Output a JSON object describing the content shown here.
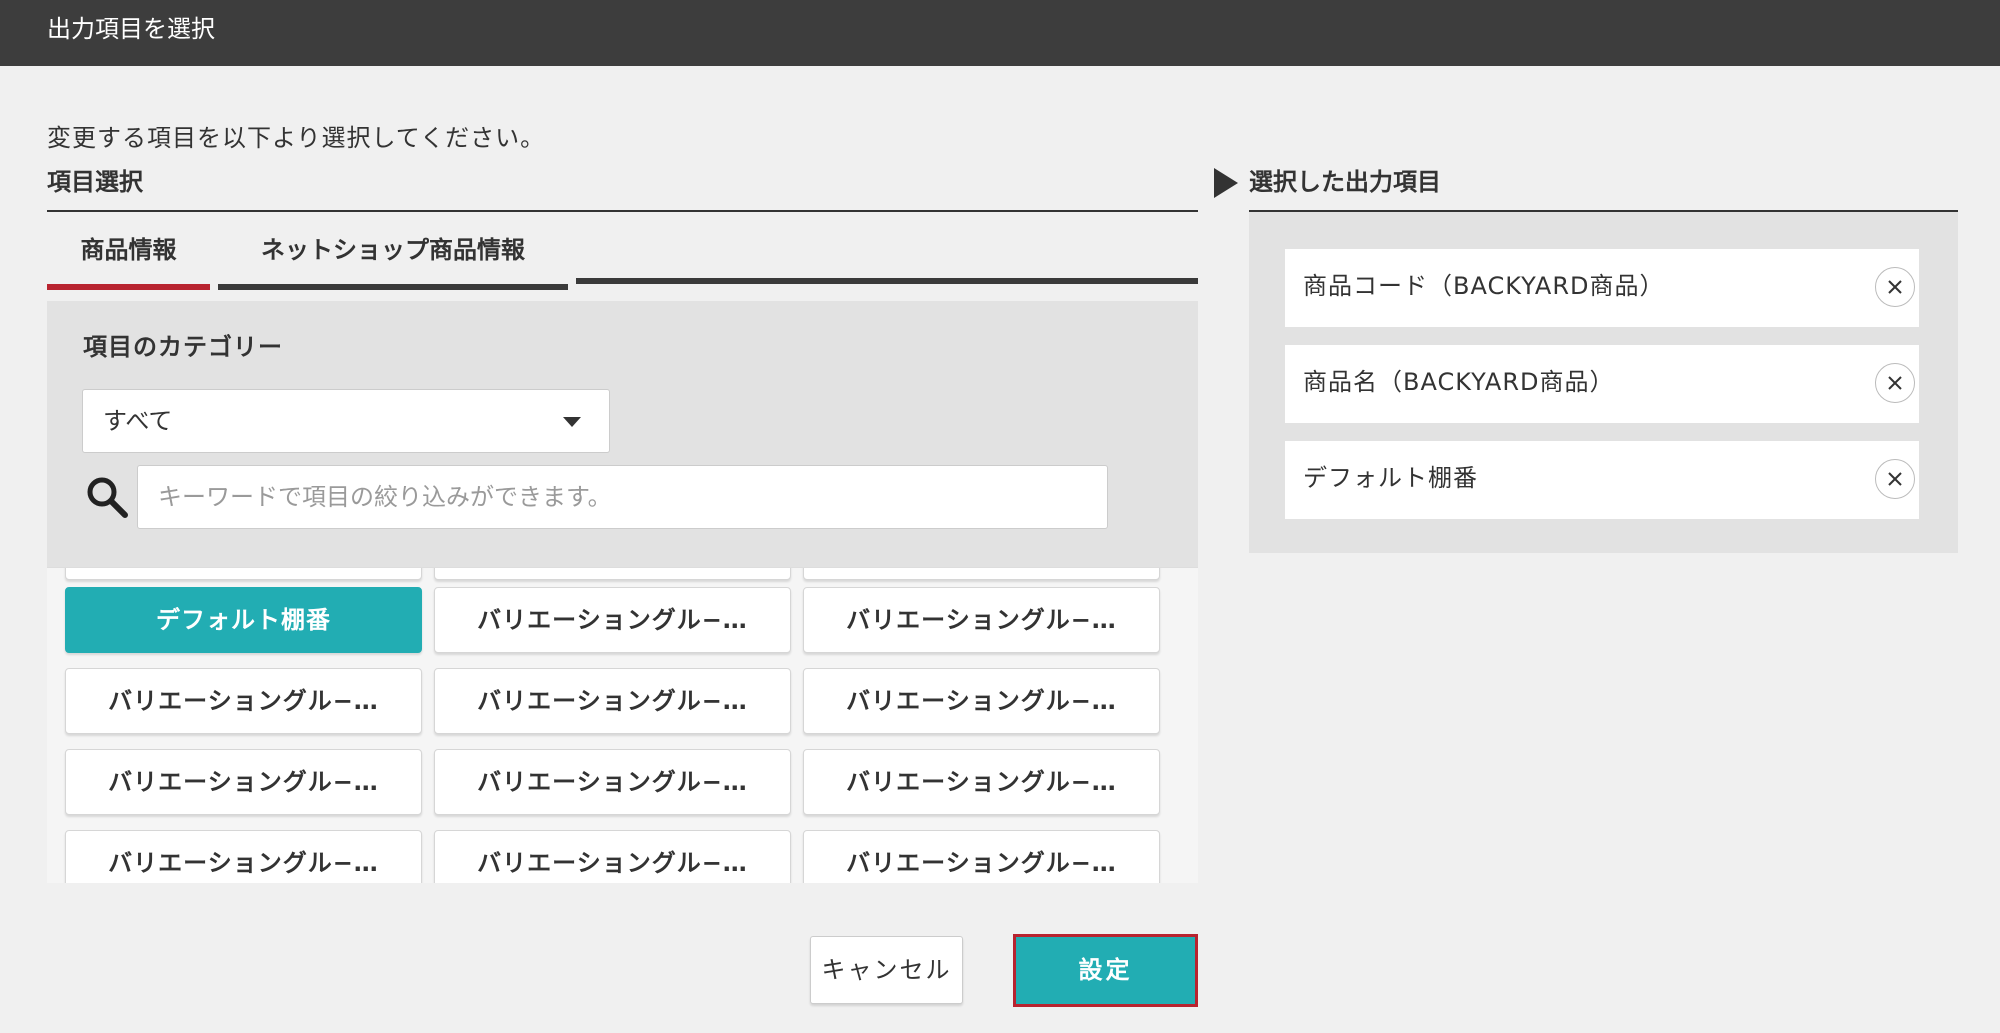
{
  "dialog": {
    "title": "出力項目を選択"
  },
  "instruction": "変更する項目を以下より選択してください。",
  "item_selection": {
    "section_title": "項目選択",
    "tabs": [
      {
        "label": "商品情報",
        "active": true
      },
      {
        "label": "ネットショップ商品情報",
        "active": false
      }
    ],
    "category_label": "項目のカテゴリー",
    "category_select": {
      "value": "すべて"
    },
    "search": {
      "placeholder": "キーワードで項目の絞り込みができます。",
      "value": ""
    },
    "tiles": [
      {
        "label": "デフォルト棚番",
        "selected": true
      },
      {
        "label": "バリエーショングル−…",
        "selected": false
      },
      {
        "label": "バリエーショングル−…",
        "selected": false
      },
      {
        "label": "バリエーショングル−…",
        "selected": false
      },
      {
        "label": "バリエーショングル−…",
        "selected": false
      },
      {
        "label": "バリエーショングル−…",
        "selected": false
      },
      {
        "label": "バリエーショングル−…",
        "selected": false
      },
      {
        "label": "バリエーショングル−…",
        "selected": false
      },
      {
        "label": "バリエーショングル−…",
        "selected": false
      },
      {
        "label": "バリエーショングル−…",
        "selected": false
      },
      {
        "label": "バリエーショングル−…",
        "selected": false
      },
      {
        "label": "バリエーショングル−…",
        "selected": false
      }
    ]
  },
  "selected_outputs": {
    "title": "選択した出力項目",
    "items": [
      {
        "label": "商品コード（BACKYARD商品）"
      },
      {
        "label": "商品名（BACKYARD商品）"
      },
      {
        "label": "デフォルト棚番"
      }
    ]
  },
  "footer": {
    "cancel_label": "キャンセル",
    "set_label": "設定"
  },
  "colors": {
    "accent_teal": "#22adb3",
    "active_tab_red": "#b8232f",
    "header_bg": "#3d3d3d"
  },
  "icons": {
    "search": "search-icon",
    "dropdown": "chevron-down-icon",
    "remove": "close-icon",
    "section_marker": "triangle-right-icon"
  }
}
